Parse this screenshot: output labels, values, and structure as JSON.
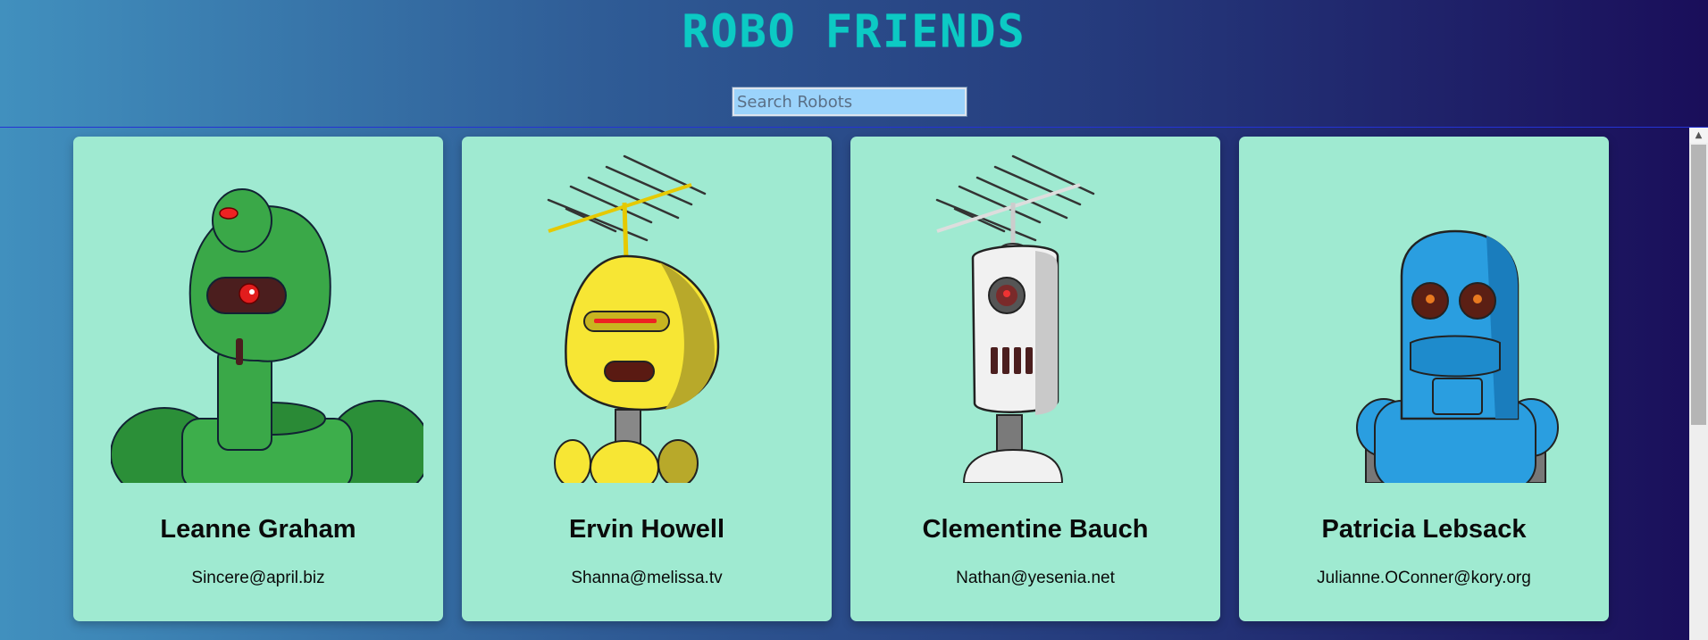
{
  "app": {
    "title": "ROBO FRIENDS"
  },
  "search": {
    "placeholder": "Search Robots",
    "value": ""
  },
  "robots": [
    {
      "name": "Leanne Graham",
      "email": "Sincere@april.biz",
      "color": "#2f9e3e",
      "icon": "green-robot"
    },
    {
      "name": "Ervin Howell",
      "email": "Shanna@melissa.tv",
      "color": "#f3e02e",
      "icon": "yellow-robot"
    },
    {
      "name": "Clementine Bauch",
      "email": "Nathan@yesenia.net",
      "color": "#e6e6e6",
      "icon": "white-robot"
    },
    {
      "name": "Patricia Lebsack",
      "email": "Julianne.OConner@kory.org",
      "color": "#2a9ee0",
      "icon": "blue-robot"
    }
  ],
  "theme": {
    "card_bg": "#9fead1",
    "title_color": "#0ccac4"
  },
  "scrollbar": {
    "up_icon": "triangle-up-icon"
  }
}
